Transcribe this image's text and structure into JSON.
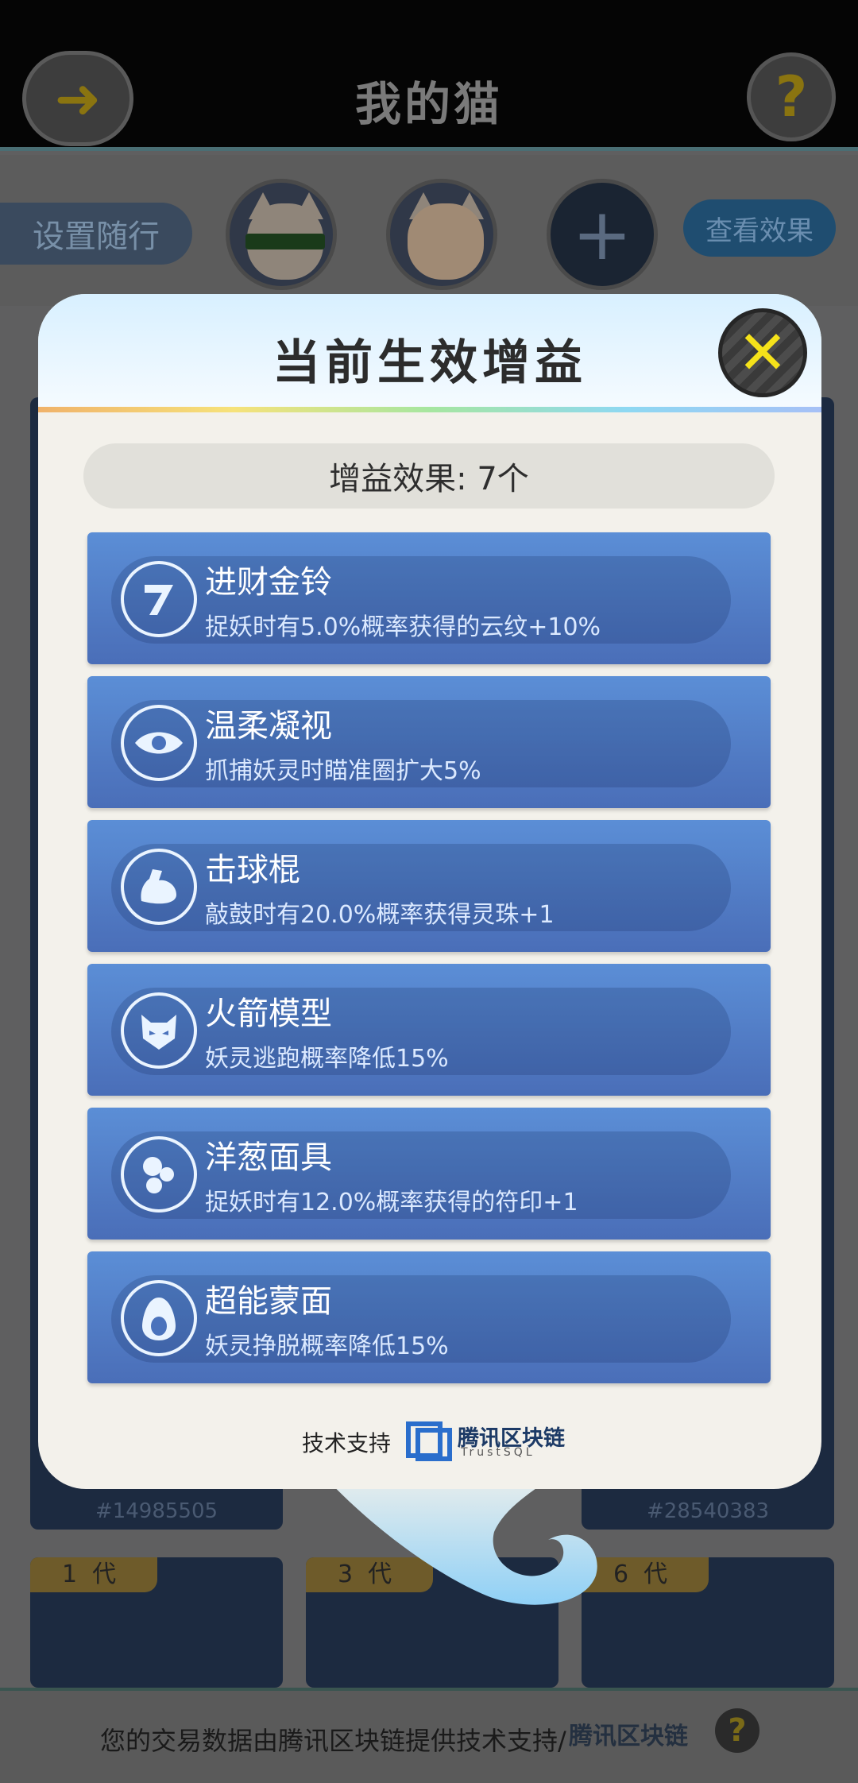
{
  "app": {
    "title": "我的猫",
    "back_icon": "arrow-left-icon",
    "help_icon": "question-icon",
    "follow_button": "设置随行",
    "add_cat_icon": "plus-icon",
    "view_effect_button": "查看效果"
  },
  "cards": [
    {
      "id_text": "#14985505"
    },
    {
      "id_text": "#28540383"
    },
    {
      "generation": "1",
      "generation_suffix": "代"
    },
    {
      "generation": "3",
      "generation_suffix": "代"
    },
    {
      "generation": "6",
      "generation_suffix": "代"
    }
  ],
  "modal": {
    "title": "当前生效增益",
    "close_icon": "close-x-icon",
    "count_label": "增益效果: 7个",
    "buffs": [
      {
        "name": "进财金铃",
        "desc": "捉妖时有5.0%概率获得的云纹+10%",
        "icon": "bell-icon"
      },
      {
        "name": "温柔凝视",
        "desc": "抓捕妖灵时瞄准圈扩大5%",
        "icon": "eye-icon"
      },
      {
        "name": "击球棍",
        "desc": "敲鼓时有20.0%概率获得灵珠+1",
        "icon": "muscle-arm-icon"
      },
      {
        "name": "火箭模型",
        "desc": "妖灵逃跑概率降低15%",
        "icon": "monster-face-icon"
      },
      {
        "name": "洋葱面具",
        "desc": "捉妖时有12.0%概率获得的符印+1",
        "icon": "bubbles-icon"
      },
      {
        "name": "超能蒙面",
        "desc": "妖灵挣脱概率降低15%",
        "icon": "egg-icon"
      }
    ],
    "support_label": "技术支持",
    "support_brand": "腾讯区块链",
    "support_brand_sub": "TrustSQL"
  },
  "footer": {
    "text": "您的交易数据由腾讯区块链提供技术支持/",
    "brand": "腾讯区块链",
    "help_icon": "question-icon"
  },
  "colors": {
    "modal_bg": "#f3f1eb",
    "buff_card": "#5b8ed6",
    "close_accent": "#f5e21a",
    "rainbow_start": "#f0b26a",
    "rainbow_end": "#a6c0f6"
  }
}
